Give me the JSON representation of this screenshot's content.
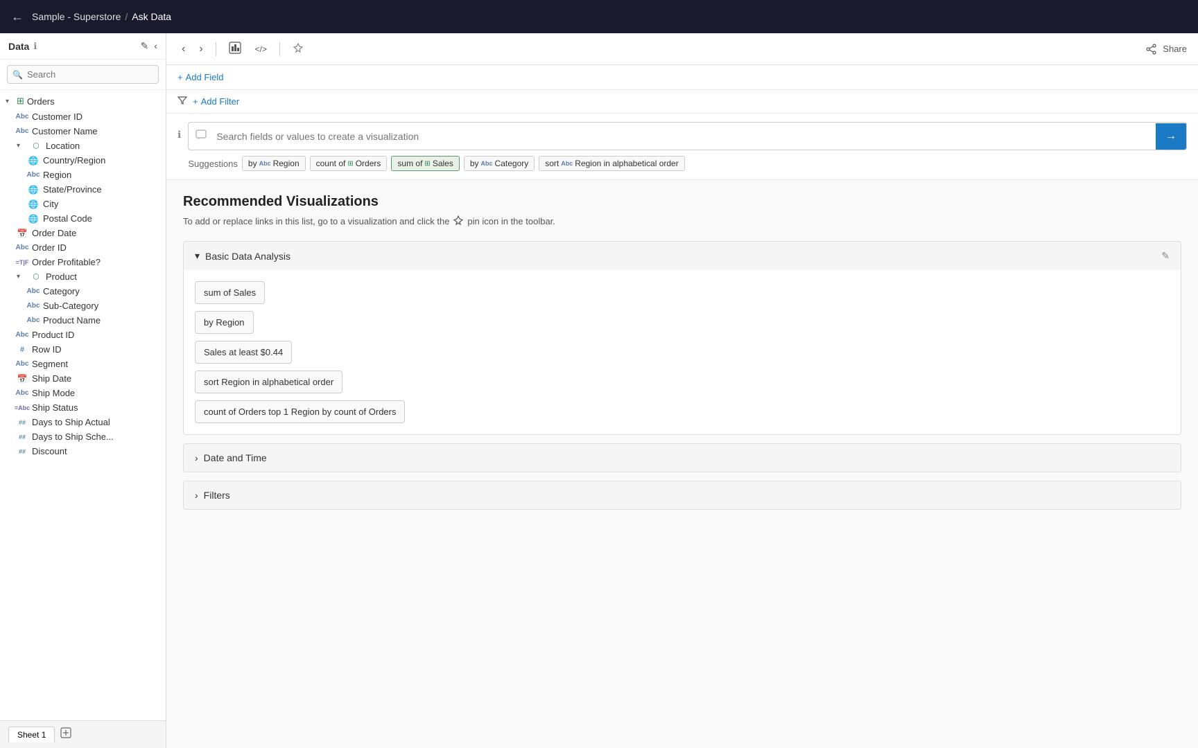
{
  "topbar": {
    "back_icon": "←",
    "title": "Sample - Superstore",
    "separator": "/",
    "page": "Ask Data"
  },
  "sidebar": {
    "title": "Data",
    "info_icon": "ℹ",
    "edit_icon": "✎",
    "collapse_icon": "‹",
    "search_placeholder": "Search",
    "groups": [
      {
        "id": "orders",
        "label": "Orders",
        "icon": "table",
        "expanded": true,
        "children": [
          {
            "id": "customer-id",
            "label": "Customer ID",
            "type": "abc"
          },
          {
            "id": "customer-name",
            "label": "Customer Name",
            "type": "abc"
          },
          {
            "id": "location",
            "label": "Location",
            "type": "cluster",
            "expanded": true,
            "children": [
              {
                "id": "country-region",
                "label": "Country/Region",
                "type": "globe"
              },
              {
                "id": "region",
                "label": "Region",
                "type": "abc"
              },
              {
                "id": "state-province",
                "label": "State/Province",
                "type": "globe"
              },
              {
                "id": "city",
                "label": "City",
                "type": "globe"
              },
              {
                "id": "postal-code",
                "label": "Postal Code",
                "type": "globe"
              }
            ]
          },
          {
            "id": "order-date",
            "label": "Order Date",
            "type": "calendar"
          },
          {
            "id": "order-id",
            "label": "Order ID",
            "type": "abc"
          },
          {
            "id": "order-profitable",
            "label": "Order Profitable?",
            "type": "tif"
          },
          {
            "id": "product",
            "label": "Product",
            "type": "cluster",
            "expanded": true,
            "children": [
              {
                "id": "category",
                "label": "Category",
                "type": "abc"
              },
              {
                "id": "sub-category",
                "label": "Sub-Category",
                "type": "abc"
              },
              {
                "id": "product-name",
                "label": "Product Name",
                "type": "abc"
              }
            ]
          },
          {
            "id": "product-id",
            "label": "Product ID",
            "type": "abc"
          },
          {
            "id": "row-id",
            "label": "Row ID",
            "type": "hash"
          },
          {
            "id": "segment",
            "label": "Segment",
            "type": "abc"
          },
          {
            "id": "ship-date",
            "label": "Ship Date",
            "type": "calendar"
          },
          {
            "id": "ship-mode",
            "label": "Ship Mode",
            "type": "abc"
          },
          {
            "id": "ship-status",
            "label": "Ship Status",
            "type": "tif"
          },
          {
            "id": "days-ship-actual",
            "label": "Days to Ship Actual",
            "type": "hash2"
          },
          {
            "id": "days-ship-sche",
            "label": "Days to Ship Sche...",
            "type": "hash2"
          },
          {
            "id": "discount",
            "label": "Discount",
            "type": "hash2"
          }
        ]
      }
    ]
  },
  "toolbar": {
    "back_btn": "‹",
    "forward_btn": "›",
    "viz_btn": "⊞",
    "code_btn": "</>",
    "pin_btn": "⊹",
    "share_label": "Share",
    "share_icon": "⤴"
  },
  "add_field": {
    "icon": "+",
    "label": "Add Field"
  },
  "add_filter": {
    "icon": "+",
    "label": "Add Filter",
    "filter_icon": "▽"
  },
  "search_bar": {
    "placeholder": "Search fields or values to create a visualization",
    "submit_icon": "→",
    "info_icon": "ℹ"
  },
  "suggestions": {
    "label": "Suggestions",
    "chips": [
      {
        "id": "by-region",
        "prefix": "by",
        "icon_type": "abc",
        "text": "Region"
      },
      {
        "id": "count-orders",
        "prefix": "count of",
        "icon_type": "table",
        "text": "Orders"
      },
      {
        "id": "sum-sales",
        "prefix": "sum of",
        "icon_type": "table",
        "text": "Sales"
      },
      {
        "id": "by-category",
        "prefix": "by",
        "icon_type": "abc",
        "text": "Category"
      },
      {
        "id": "sort-region",
        "prefix": "sort",
        "icon_type": "abc",
        "text": "Region in alphabetical order"
      }
    ]
  },
  "recommended": {
    "title": "Recommended Visualizations",
    "subtitle_before": "To add or replace links in this list, go to a visualization and click the",
    "subtitle_pin": "⊹",
    "subtitle_after": "pin icon in the toolbar.",
    "groups": [
      {
        "id": "basic-data-analysis",
        "label": "Basic Data Analysis",
        "expanded": true,
        "edit_icon": "✎",
        "chips": [
          "sum of Sales",
          "by Region",
          "Sales at least $0.44",
          "sort Region in alphabetical order",
          "count of Orders top 1 Region by count of Orders"
        ]
      },
      {
        "id": "date-and-time",
        "label": "Date and Time",
        "expanded": false,
        "chips": []
      },
      {
        "id": "filters",
        "label": "Filters",
        "expanded": false,
        "chips": []
      }
    ]
  },
  "bottom_bar": {
    "sheet_label": "Sheet 1",
    "add_icon": "⊞"
  }
}
